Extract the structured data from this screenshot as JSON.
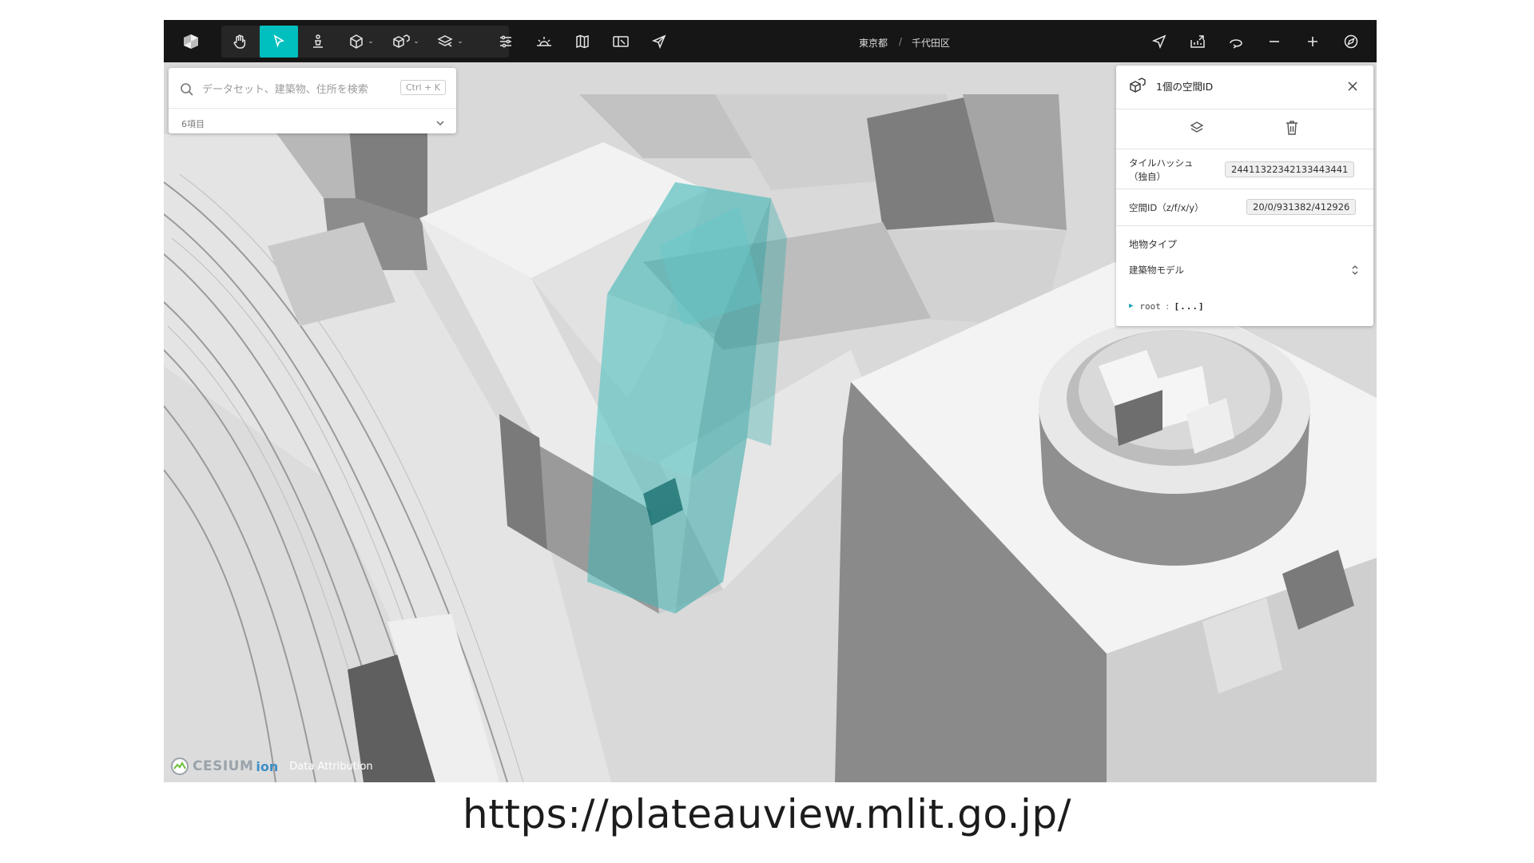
{
  "toolbar": {
    "app_logo": "plateau-cube-logo",
    "tools": [
      {
        "name": "hand-pan-tool",
        "icon": "hand-icon"
      },
      {
        "name": "select-tool",
        "icon": "cursor-arrow-icon",
        "active": true,
        "accent": "#00bfbf"
      },
      {
        "name": "pedestrian-tool",
        "icon": "person-icon"
      },
      {
        "name": "cube-tool",
        "icon": "cube-icon"
      },
      {
        "name": "spatial-id-tool",
        "icon": "spatial-id-cube-icon"
      },
      {
        "name": "layers-tool",
        "icon": "layers-icon"
      }
    ],
    "right_tools": [
      "settings-sliders-icon",
      "sun-horizon-icon",
      "map-icon",
      "panel-icon",
      "share-send-icon"
    ],
    "right_controls": [
      "navigate-arrow-icon",
      "export-icon",
      "rotate-icon",
      "zoom-out-icon",
      "zoom-in-icon",
      "compass-icon"
    ]
  },
  "breadcrumb": {
    "prefecture": "東京都",
    "separator": "/",
    "ward": "千代田区"
  },
  "search": {
    "placeholder": "データセット、建築物、住所を検索",
    "shortcut": "Ctrl + K",
    "count_label": "6項目"
  },
  "panel": {
    "title": "1個の空間ID",
    "rows": [
      {
        "label": "タイルハッシュ（独自）",
        "value": "24411322342133443441"
      },
      {
        "label": "空間ID（z/f/x/y）",
        "value": "20/0/931382/412926"
      }
    ],
    "feature_type_label": "地物タイプ",
    "feature_type_value": "建築物モデル",
    "tree_key": "root",
    "tree_sep": ":",
    "tree_value": "[...]"
  },
  "attribution": {
    "cesium": "CESIUM",
    "ion": "ion",
    "data_attribution": "Data Attribution"
  },
  "url": "https://plateauview.mlit.go.jp/",
  "colors": {
    "toolbar_bg": "#161616",
    "accent": "#00bfbf",
    "highlight_volume": "#3cb4b4"
  }
}
